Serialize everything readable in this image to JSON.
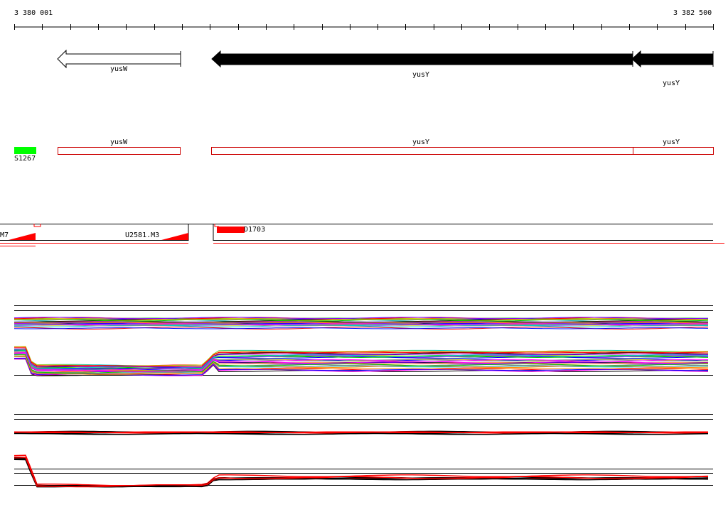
{
  "ruler": {
    "start_label": "3 380 001",
    "end_label": "3 382 500"
  },
  "genes": [
    {
      "name": "yusW",
      "strand": "minus",
      "style": "outline"
    },
    {
      "name": "yusY",
      "strand": "minus",
      "style": "filled"
    },
    {
      "name": "yusY",
      "strand": "minus",
      "style": "filled"
    }
  ],
  "features": {
    "marker_label": "S1267",
    "marker_color": "#00ff00",
    "boxes": [
      "yusW",
      "yusY",
      "yusY"
    ],
    "box_color": "#cc0000"
  },
  "segments": {
    "left_label": "M7",
    "mid_label": "U2581.M3",
    "right_label": "D1703",
    "color": "#ff0000"
  },
  "tracks": {
    "line_colors": [
      "#000000",
      "#ff0000",
      "#00cc00",
      "#0000ff",
      "#ff00ff",
      "#00cccc",
      "#cccc00",
      "#ff8800",
      "#8800ff",
      "#888888"
    ],
    "highlight_color": "#ff0000"
  }
}
